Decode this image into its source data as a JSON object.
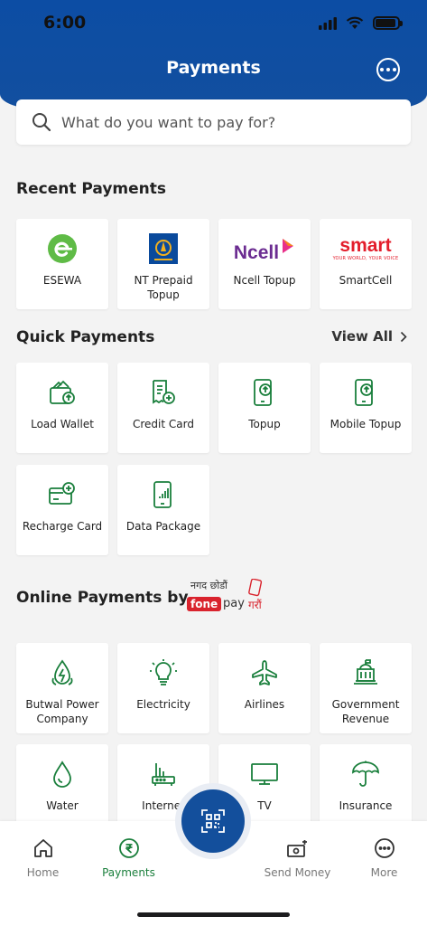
{
  "status": {
    "time": "6:00"
  },
  "header": {
    "title": "Payments"
  },
  "search": {
    "placeholder": "What do you want to pay for?"
  },
  "recent": {
    "title": "Recent Payments",
    "items": [
      {
        "label": "ESEWA",
        "icon": "esewa-logo"
      },
      {
        "label": "NT Prepaid Topup",
        "icon": "ntc-logo"
      },
      {
        "label": "Ncell Topup",
        "icon": "ncell-logo",
        "logo_text": "Ncell"
      },
      {
        "label": "SmartCell",
        "icon": "smart-logo",
        "logo_text": "smart",
        "logo_sub": "YOUR WORLD, YOUR VOICE"
      }
    ]
  },
  "quick": {
    "title": "Quick Payments",
    "view_all": "View All",
    "items": [
      {
        "label": "Load Wallet",
        "icon": "wallet-upload-icon"
      },
      {
        "label": "Credit Card",
        "icon": "receipt-add-icon"
      },
      {
        "label": "Topup",
        "icon": "phone-upload-icon"
      },
      {
        "label": "Mobile Topup",
        "icon": "phone-upload-icon"
      },
      {
        "label": "Recharge Card",
        "icon": "card-add-icon"
      },
      {
        "label": "Data Package",
        "icon": "phone-signal-icon"
      }
    ]
  },
  "online": {
    "title": "Online Payments by",
    "brand_top": "नगद छोडौं",
    "brand_fone": "fone",
    "brand_pay": "pay",
    "brand_right": "गरौं",
    "items": [
      {
        "label": "Butwal Power Company",
        "icon": "power-drop-icon"
      },
      {
        "label": "Electricity",
        "icon": "bulb-icon"
      },
      {
        "label": "Airlines",
        "icon": "airplane-icon"
      },
      {
        "label": "Government Revenue",
        "icon": "government-building-icon"
      },
      {
        "label": "Water",
        "icon": "water-drop-icon"
      },
      {
        "label": "Internet",
        "icon": "router-icon"
      },
      {
        "label": "TV",
        "icon": "tv-icon"
      },
      {
        "label": "Insurance",
        "icon": "umbrella-icon"
      }
    ]
  },
  "nav": {
    "home": "Home",
    "payments": "Payments",
    "send_money": "Send Money",
    "more": "More"
  },
  "colors": {
    "primary": "#124f9f",
    "accent": "#1a7f3c",
    "smart_red": "#e31d2b",
    "ncell_purple": "#6b2c91"
  }
}
